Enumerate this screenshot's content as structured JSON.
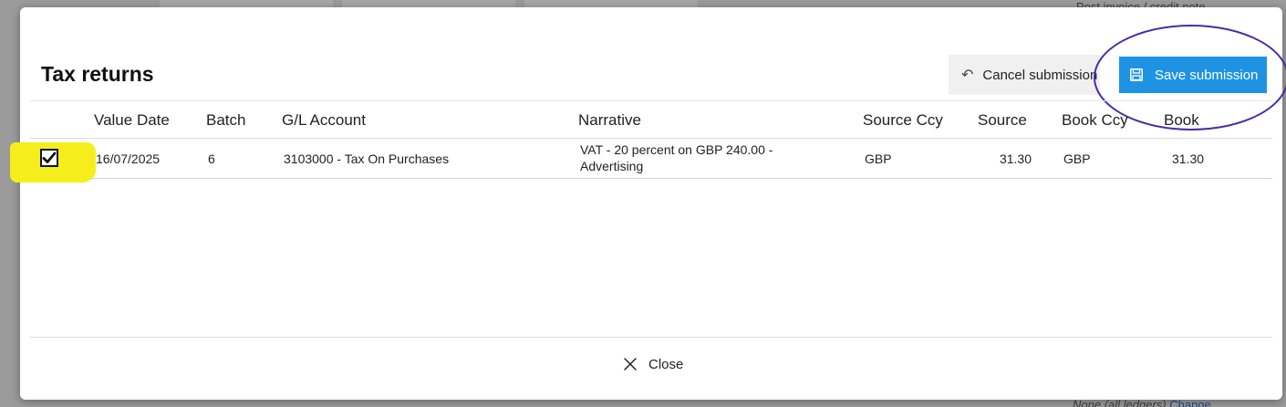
{
  "background": {
    "top_right_text": "Post invoice / credit note",
    "bottom_right_text": "None (all ledgers)",
    "bottom_right_link": "Change"
  },
  "dialog": {
    "title": "Tax returns",
    "cancel_label": "Cancel submission",
    "save_label": "Save submission",
    "close_label": "Close",
    "colors": {
      "save_button": "#1e93e4",
      "annotation_circle": "#4b2aa8",
      "annotation_highlight": "#f5ee1c"
    },
    "icons": {
      "cancel": "undo-icon",
      "save": "save-icon",
      "close": "close-icon",
      "check": "check-icon"
    }
  },
  "table": {
    "headers": {
      "value_date": "Value Date",
      "batch": "Batch",
      "gl_account": "G/L Account",
      "narrative": "Narrative",
      "source_ccy": "Source Ccy",
      "source": "Source",
      "book_ccy": "Book Ccy",
      "book": "Book"
    },
    "rows": [
      {
        "checked": true,
        "value_date": "16/07/2025",
        "batch": "6",
        "gl_account": "3103000 - Tax On Purchases",
        "narrative": "VAT - 20 percent on GBP 240.00 - Advertising",
        "source_ccy": "GBP",
        "source": "31.30",
        "book_ccy": "GBP",
        "book": "31.30"
      }
    ]
  }
}
